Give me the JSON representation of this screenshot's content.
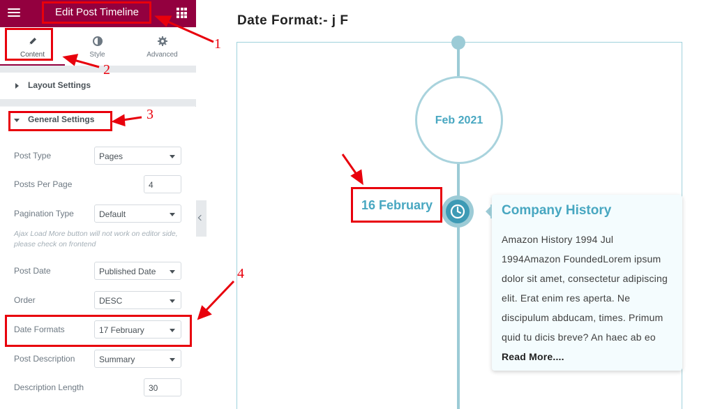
{
  "panel": {
    "title": "Edit Post Timeline",
    "tabs": [
      {
        "label": "Content",
        "icon": "pencil-icon",
        "active": true
      },
      {
        "label": "Style",
        "icon": "half-circle-icon",
        "active": false
      },
      {
        "label": "Advanced",
        "icon": "gear-icon",
        "active": false
      }
    ],
    "sections": {
      "layout": "Layout Settings",
      "general": "General Settings"
    },
    "controls": {
      "post_type": {
        "label": "Post Type",
        "value": "Pages"
      },
      "posts_per_page": {
        "label": "Posts Per Page",
        "value": "4"
      },
      "pagination_type": {
        "label": "Pagination Type",
        "value": "Default"
      },
      "pagination_note": "Ajax Load More button will not work on editor side, please check on frontend",
      "post_date": {
        "label": "Post Date",
        "value": "Published Date"
      },
      "order": {
        "label": "Order",
        "value": "DESC"
      },
      "date_formats": {
        "label": "Date Formats",
        "value": "17 February"
      },
      "post_description": {
        "label": "Post Description",
        "value": "Summary"
      },
      "description_length": {
        "label": "Description Length",
        "value": "30"
      }
    },
    "accent_color": "#93003f"
  },
  "preview": {
    "heading": "Date Format:- j F",
    "month_label": "Feb 2021",
    "event_date": "16 February",
    "card": {
      "title": "Company History",
      "body": "Amazon History 1994 Jul 1994Amazon FoundedLorem ipsum dolor sit amet, consectetur adipiscing elit. Erat enim res aperta. Ne discipulum abducam, times. Primum quid tu dicis breve? An haec ab eo ",
      "read_more": "Read More...."
    },
    "accent_color": "#48a7c1"
  },
  "annotations": {
    "labels": [
      "1",
      "2",
      "3",
      "4"
    ],
    "color": "#e8000c"
  }
}
